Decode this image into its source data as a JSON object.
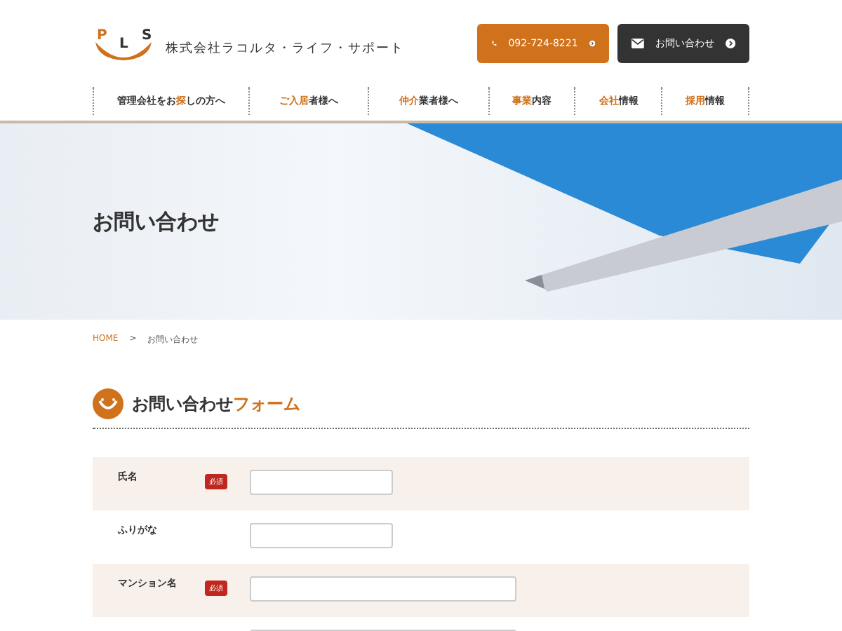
{
  "header": {
    "logo_letters": [
      "P",
      "L",
      "S"
    ],
    "company": "株式会社ラコルタ・ライフ・サポート",
    "phone": "092-724-8221",
    "contact_button": "お問い合わせ"
  },
  "nav": [
    {
      "before": "管理会社をお",
      "accent": "探",
      "after": "しの方へ"
    },
    {
      "accent": "ご入居",
      "after": "者様へ"
    },
    {
      "accent": "仲介",
      "after": "業者様へ"
    },
    {
      "accent": "事業",
      "after": "内容"
    },
    {
      "accent": "会社",
      "after": "情報"
    },
    {
      "accent": "採用",
      "after": "情報"
    }
  ],
  "hero": {
    "title": "お問い合わせ"
  },
  "breadcrumb": {
    "home": "HOME",
    "separator": ">",
    "current": "お問い合わせ"
  },
  "section": {
    "title": "お問い合わせ",
    "title_accent": "フォーム"
  },
  "form": [
    {
      "label": "氏名",
      "badge": "必須",
      "wide": false
    },
    {
      "label": "ふりがな",
      "wide": false
    },
    {
      "label": "マンション名",
      "badge": "必須",
      "wide": true
    },
    {
      "wide": true
    }
  ]
}
